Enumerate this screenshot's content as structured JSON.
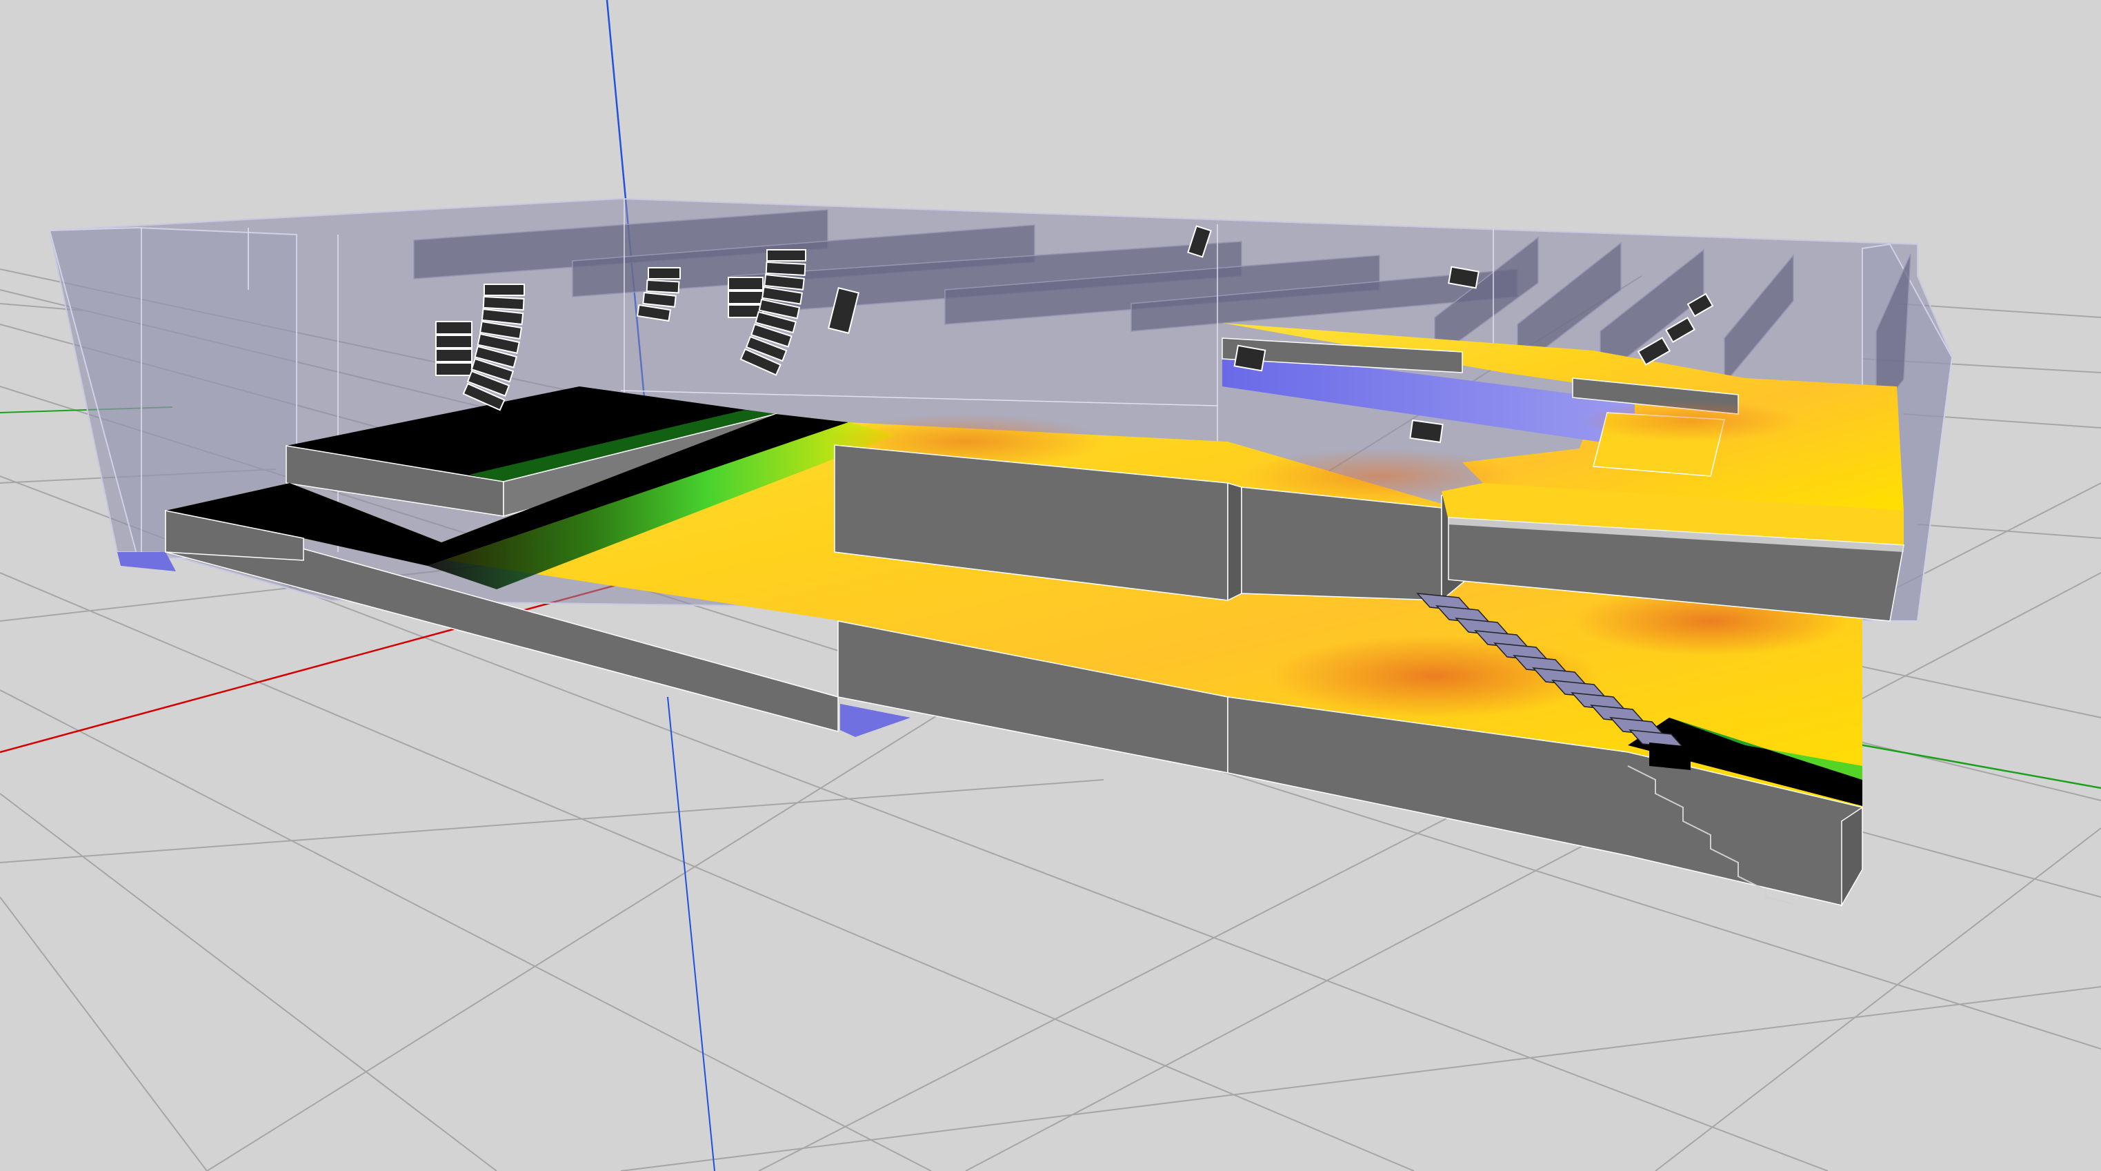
{
  "viewport": {
    "background": "#d3d3d3",
    "grid_color": "#a6a6a6",
    "axis_colors": {
      "x": "#d40000",
      "y": "#1aa01a",
      "z": "#2050e0"
    }
  },
  "venue": {
    "box_color": "#8c8caa",
    "wall_color": "#6c6c6c",
    "floor_void_color": "#7070e0"
  },
  "spl_map": {
    "colors": {
      "high": "#e8801e",
      "mid": "#ffd21e",
      "low": "#f6f000",
      "edge": "#28d230",
      "none": "#000000"
    }
  },
  "loudspeakers": {
    "line_arrays": 3,
    "single_cabinets": 6,
    "color": "#2a2a2a"
  }
}
